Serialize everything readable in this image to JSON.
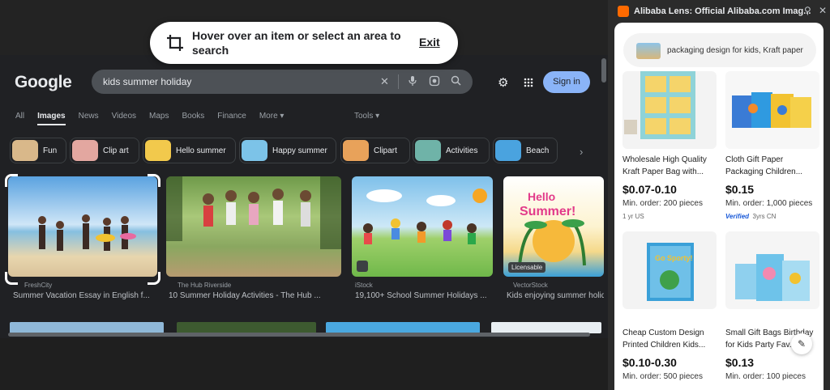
{
  "overlay": {
    "message": "Hover over an item or select an area to search",
    "exit_label": "Exit"
  },
  "google": {
    "logo": "Google",
    "search_query": "kids summer holiday",
    "signin_label": "Sign in",
    "tabs": [
      "All",
      "Images",
      "News",
      "Videos",
      "Maps",
      "Books",
      "Finance",
      "More ▾"
    ],
    "tools_label": "Tools ▾",
    "chips": [
      {
        "label": "Fun",
        "color": "#d9b88a"
      },
      {
        "label": "Clip art",
        "color": "#e3a7a0"
      },
      {
        "label": "Hello summer",
        "color": "#f2c94c"
      },
      {
        "label": "Happy summer",
        "color": "#7cc3e8"
      },
      {
        "label": "Clipart",
        "color": "#e8a25a"
      },
      {
        "label": "Activities",
        "color": "#6fb3a8"
      },
      {
        "label": "Beach",
        "color": "#4aa3df"
      }
    ],
    "results": [
      {
        "source": "FreshCity",
        "title": "Summer Vacation Essay in English f..."
      },
      {
        "source": "The Hub Riverside",
        "title": "10 Summer Holiday Activities - The Hub ..."
      },
      {
        "source": "iStock",
        "title": "19,100+ School Summer Holidays ..."
      },
      {
        "source": "VectorStock",
        "title": "Kids enjoying summer holid"
      }
    ],
    "badge_licensable": "Licensable"
  },
  "panel": {
    "title": "Alibaba Lens: Official Alibaba.com Imag...",
    "query": "packaging design for kids, Kraft paper",
    "products": [
      {
        "name": "Wholesale High Quality Kraft Paper Bag with...",
        "price": "$0.07-0.10",
        "moq": "Min. order: 200 pieces",
        "meta": "1 yr  US",
        "verified": ""
      },
      {
        "name": "Cloth Gift Paper Packaging Children...",
        "price": "$0.15",
        "moq": "Min. order: 1,000 pieces",
        "meta": "3yrs  CN",
        "verified": "Verified"
      },
      {
        "name": "Cheap Custom Design Printed Children Kids...",
        "price": "$0.10-0.30",
        "moq": "Min. order: 500 pieces",
        "meta": "",
        "verified": ""
      },
      {
        "name": "Small Gift Bags Birthday for Kids Party Fav...",
        "price": "$0.13",
        "moq": "Min. order: 100 pieces",
        "meta": "",
        "verified": ""
      }
    ]
  },
  "icons": {
    "crop": "crop-icon",
    "search": "search-icon",
    "mic": "mic-icon",
    "lens": "lens-icon",
    "clear": "close-icon",
    "settings": "gear-icon",
    "apps": "apps-icon",
    "pin": "pin-icon",
    "close": "close-icon"
  }
}
